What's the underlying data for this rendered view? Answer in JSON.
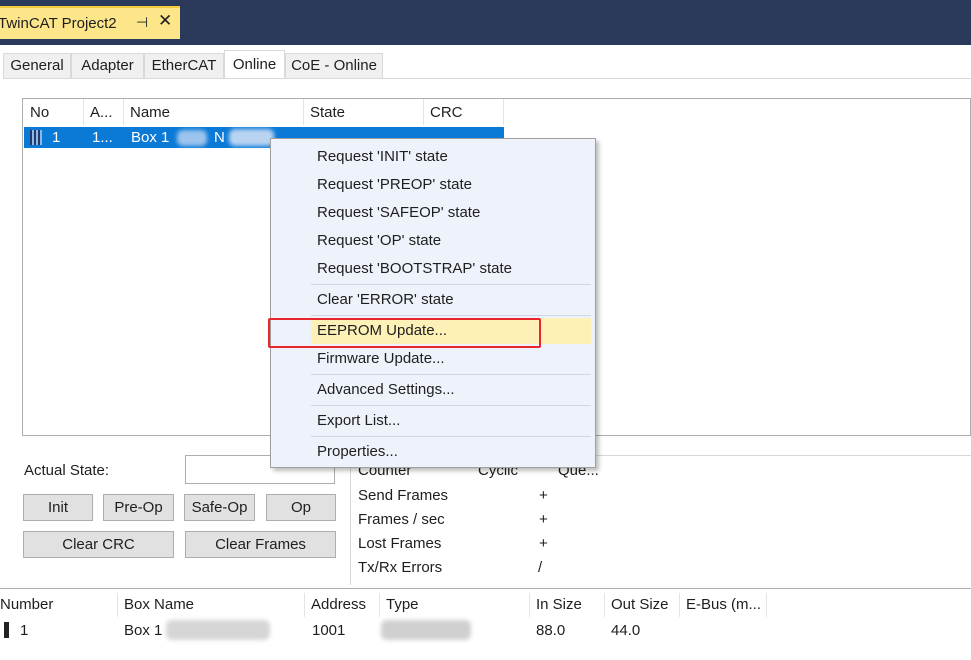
{
  "doc_tab": {
    "title": "TwinCAT Project2",
    "pin_glyph": "⊣",
    "close_glyph": "✕"
  },
  "tabs": [
    {
      "label": "General",
      "active": false
    },
    {
      "label": "Adapter",
      "active": false
    },
    {
      "label": "EtherCAT",
      "active": false
    },
    {
      "label": "Online",
      "active": true
    },
    {
      "label": "CoE - Online",
      "active": false
    }
  ],
  "device_list": {
    "columns": [
      "No",
      "A...",
      "Name",
      "State",
      "CRC"
    ],
    "rows": [
      {
        "no": "1",
        "addr": "1...",
        "name": "Box 1",
        "name_suffix": "N"
      }
    ]
  },
  "state_panel": {
    "actual_state_label": "Actual State:",
    "actual_state_value": "",
    "buttons": {
      "init": "Init",
      "pre_op": "Pre-Op",
      "safe_op": "Safe-Op",
      "op": "Op",
      "clear_crc": "Clear CRC",
      "clear_frames": "Clear Frames"
    }
  },
  "counters": {
    "headers": [
      "Counter",
      "Cyclic",
      "Que..."
    ],
    "rows": [
      {
        "label": "Send Frames",
        "value": "+"
      },
      {
        "label": "Frames / sec",
        "value": "+"
      },
      {
        "label": "Lost Frames",
        "value": "+"
      },
      {
        "label": "Tx/Rx Errors",
        "value": "/"
      }
    ]
  },
  "bottom_grid": {
    "columns": [
      "Number",
      "Box Name",
      "Address",
      "Type",
      "In Size",
      "Out Size",
      "E-Bus (m..."
    ],
    "row": {
      "number": "1",
      "box_name": "Box 1",
      "address": "1001",
      "in_size": "88.0",
      "out_size": "44.0"
    }
  },
  "context_menu": {
    "items": [
      "Request 'INIT' state",
      "Request 'PREOP' state",
      "Request 'SAFEOP' state",
      "Request 'OP' state",
      "Request 'BOOTSTRAP' state",
      "Clear 'ERROR' state",
      "EEPROM Update...",
      "Firmware Update...",
      "Advanced Settings...",
      "Export List...",
      "Properties..."
    ],
    "highlighted_index": 6,
    "highlight_color": "#fdf1b8",
    "annotation_color": "#e8262b"
  },
  "colors": {
    "title_bar": "#2b3a5a",
    "doc_tab": "#fde58a",
    "selection": "#0b7ad6"
  }
}
